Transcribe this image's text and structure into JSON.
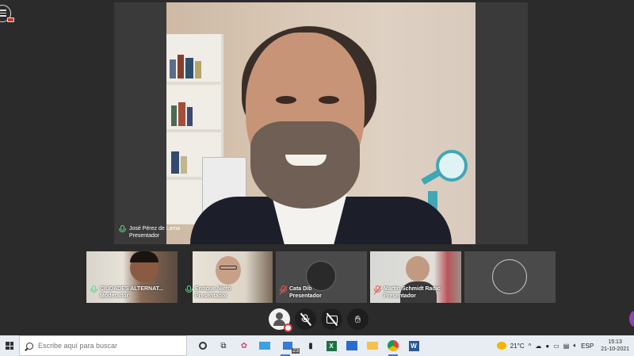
{
  "main_presenter": {
    "name": "José Pérez de Lama",
    "role": "Presentador"
  },
  "participants": [
    {
      "name": "CIUDADES ALTERNAT...",
      "role": "Moderador",
      "mic": "on"
    },
    {
      "name": "Enrique Nieto",
      "role": "Presentador",
      "mic": "on"
    },
    {
      "name": "Cata Dib",
      "role": "Presentador",
      "mic": "muted"
    },
    {
      "name": "Martin Schmidt Radic",
      "role": "Presentador",
      "mic": "muted"
    }
  ],
  "controls": {
    "icons": [
      "user-status-icon",
      "mic-off-icon",
      "camera-off-icon",
      "raise-hand-icon"
    ]
  },
  "taskbar": {
    "search_placeholder": "Escribe aquí para buscar",
    "task_badge": "23",
    "temperature": "21°C",
    "language": "ESP",
    "time": "15:13",
    "date": "21-10-2021"
  },
  "colors": {
    "background": "#2b2b2b",
    "mic_on": "#5fd389",
    "mic_muted": "#e05a5a",
    "taskbar": "#e8edf3"
  }
}
